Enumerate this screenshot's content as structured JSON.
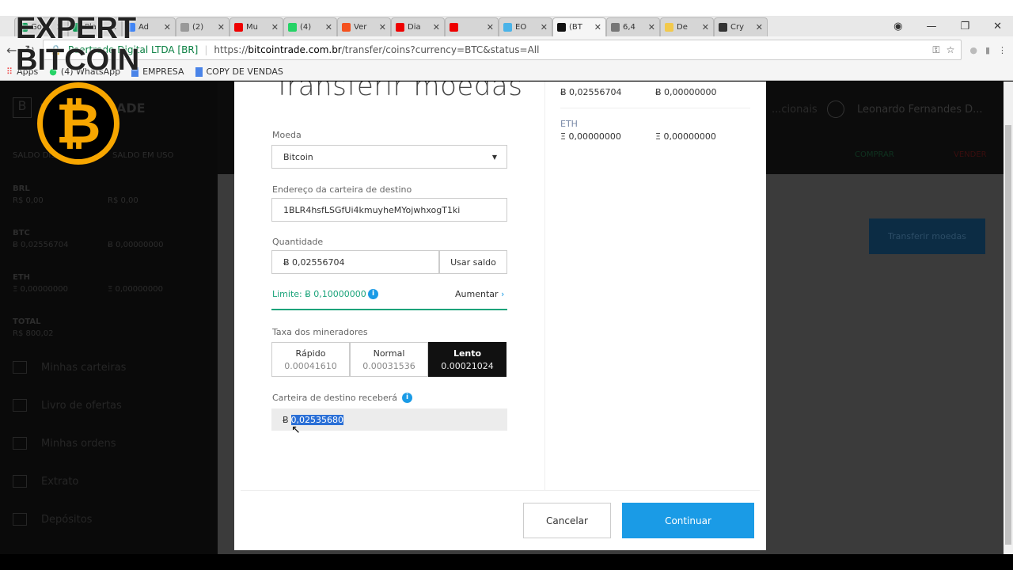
{
  "browser": {
    "tabs": [
      {
        "label": "Go",
        "color": "#0f9d58"
      },
      {
        "label": "Pla",
        "color": "#0f9d58"
      },
      {
        "label": "Ad",
        "color": "#4285f4"
      },
      {
        "label": "(2)",
        "color": "#999"
      },
      {
        "label": "Mu",
        "color": "#e00"
      },
      {
        "label": "(4)",
        "color": "#25d366"
      },
      {
        "label": "Ver",
        "color": "#f4511e"
      },
      {
        "label": "Dia",
        "color": "#e00"
      },
      {
        "label": "",
        "color": "#e00"
      },
      {
        "label": "EO",
        "color": "#4ab3e8"
      },
      {
        "label": "(BT",
        "color": "#111"
      },
      {
        "label": "6,4",
        "color": "#777"
      },
      {
        "label": "De",
        "color": "#f2c94c"
      },
      {
        "label": "Cry",
        "color": "#333"
      }
    ],
    "active_tab": 10,
    "security_label": "Peertrade Digital LTDA [BR]",
    "url_prefix": "https://",
    "url_domain": "bitcointrade.com.br",
    "url_path": "/transfer/coins?currency=BTC&status=All",
    "bookmarks": [
      "Apps",
      "(4) WhatsApp",
      "EMPRESA",
      "COPY DE VENDAS"
    ]
  },
  "watermark": {
    "text_line1": "EXPERT",
    "text_line2": "BITCOIN",
    "coin_symbol": "₿"
  },
  "sidebar": {
    "brand": "BITCOINTRADE",
    "headers": [
      "SALDO DISPONÍVEL",
      "SALDO EM USO"
    ],
    "balances": [
      {
        "currency": "BRL",
        "available": "R$ 0,00",
        "in_use": "R$ 0,00"
      },
      {
        "currency": "BTC",
        "available": "Ƀ 0,02556704",
        "in_use": "Ƀ 0,00000000"
      },
      {
        "currency": "ETH",
        "available": "Ξ 0,00000000",
        "in_use": "Ξ 0,00000000"
      }
    ],
    "total_label": "TOTAL",
    "total_value": "R$ 800,02",
    "menu": [
      "Minhas carteiras",
      "Livro de ofertas",
      "Minhas ordens",
      "Extrato",
      "Depósitos"
    ]
  },
  "header": {
    "nav_partial": "...cionais",
    "user": "Leonardo Fernandes D...",
    "buy": "COMPRAR",
    "sell": "VENDER",
    "transfer_button": "Transferir moedas"
  },
  "modal": {
    "title": "Transferir moedas",
    "coin_label": "Moeda",
    "coin_value": "Bitcoin",
    "address_label": "Endereço da carteira de destino",
    "address_value": "1BLR4hsfLSGfUi4kmuyheMYojwhxogT1ki",
    "amount_label": "Quantidade",
    "amount_value": "Ƀ 0,02556704",
    "use_balance": "Usar saldo",
    "limit": "Limite: Ƀ 0,10000000",
    "increase": "Aumentar",
    "fee_label": "Taxa dos mineradores",
    "fees": [
      {
        "name": "Rápido",
        "value": "0.00041610"
      },
      {
        "name": "Normal",
        "value": "0.00031536"
      },
      {
        "name": "Lento",
        "value": "0.00021024"
      }
    ],
    "selected_fee": 2,
    "receive_label": "Carteira de destino receberá",
    "receive_prefix": "Ƀ",
    "receive_value": "0,02535680",
    "side": {
      "btc_available": "Ƀ 0,02556704",
      "btc_in_use": "Ƀ 0,00000000",
      "eth_label": "ETH",
      "eth_available": "Ξ 0,00000000",
      "eth_in_use": "Ξ 0,00000000"
    },
    "cancel": "Cancelar",
    "continue": "Continuar",
    "accent": "#1a9be6",
    "limit_color": "#1aa37a"
  }
}
